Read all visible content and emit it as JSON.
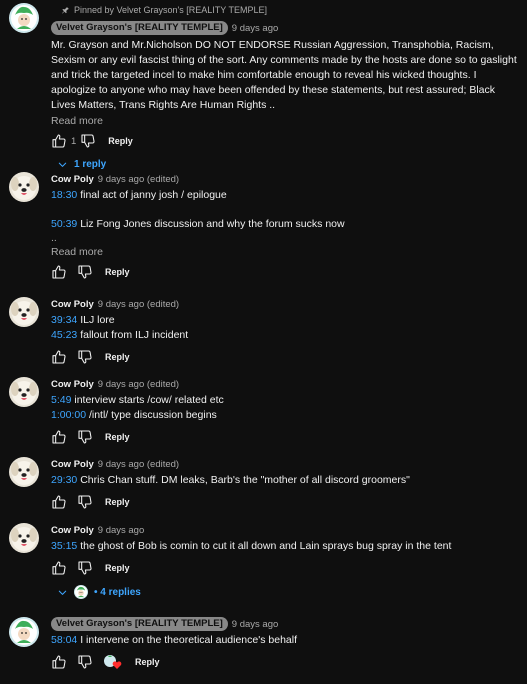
{
  "pinned": {
    "label": "Pinned by Velvet Grayson's [REALITY TEMPLE]"
  },
  "comments": [
    {
      "author": "Velvet Grayson's [REALITY TEMPLE]",
      "time": "9 days ago",
      "text": "Mr. Grayson and Mr.Nicholson DO NOT ENDORSE Russian Aggression, Transphobia, Racism, Sexism or any evil fascist thing of the sort. Any comments made by the hosts are done so to gaslight and trick the targeted incel to make him comfortable enough to reveal his wicked thoughts. I apologize to anyone who may have been offended by these statements, but rest assured; Black Lives Matters, Trans Rights Are Human Rights ..",
      "read_more": "Read more",
      "likes": "1",
      "reply_label": "Reply",
      "replies_label": "1 reply"
    },
    {
      "author": "Cow Poly",
      "time": "9 days ago (edited)",
      "lines": [
        {
          "ts": "18:30",
          "text": " final act of janny josh / epilogue"
        },
        {
          "ts": "",
          "text": ""
        },
        {
          "ts": "50:39",
          "text": " Liz Fong Jones discussion and why the forum sucks now"
        },
        {
          "ts": "",
          "text": ".."
        }
      ],
      "read_more": "Read more",
      "reply_label": "Reply"
    },
    {
      "author": "Cow Poly",
      "time": "9 days ago (edited)",
      "lines": [
        {
          "ts": "39:34",
          "text": " ILJ lore"
        },
        {
          "ts": "45:23",
          "text": " fallout from ILJ incident"
        }
      ],
      "reply_label": "Reply"
    },
    {
      "author": "Cow Poly",
      "time": "9 days ago (edited)",
      "lines": [
        {
          "ts": "5:49",
          "text": " interview starts /cow/ related etc"
        },
        {
          "ts": "1:00:00",
          "text": " /intl/ type discussion begins"
        }
      ],
      "reply_label": "Reply"
    },
    {
      "author": "Cow Poly",
      "time": "9 days ago (edited)",
      "lines": [
        {
          "ts": "29:30",
          "text": " Chris Chan stuff. DM leaks, Barb's the \"mother of all discord groomers\""
        }
      ],
      "reply_label": "Reply"
    },
    {
      "author": "Cow Poly",
      "time": "9 days ago",
      "lines": [
        {
          "ts": "35:15",
          "text": " the ghost of Bob is comin to cut it all down and Lain sprays bug spray in the tent"
        }
      ],
      "reply_label": "Reply",
      "replies_label": "4 replies"
    },
    {
      "author": "Velvet Grayson's [REALITY TEMPLE]",
      "time": "9 days ago",
      "lines": [
        {
          "ts": "58:04",
          "text": " I intervene on the theoretical audience's behalf"
        }
      ],
      "reply_label": "Reply"
    }
  ],
  "colors": {
    "background": "#0f0f0f",
    "link_blue": "#3ea6ff",
    "muted": "#aaaaaa",
    "heart_red": "#ff2d2d"
  },
  "icons": [
    "pin-icon",
    "thumbs-up-icon",
    "thumbs-down-icon",
    "chevron-down-icon",
    "heart-icon"
  ]
}
